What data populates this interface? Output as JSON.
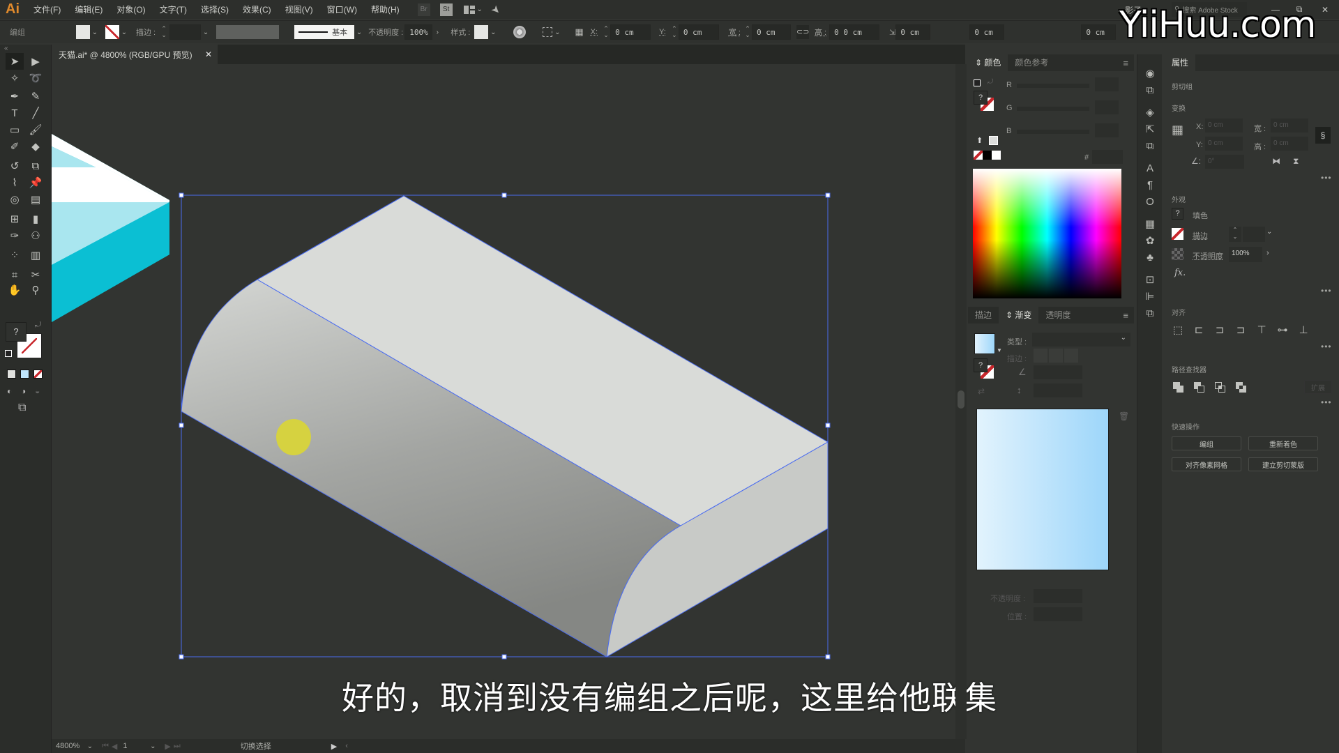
{
  "app": {
    "logo": "Ai",
    "menu": [
      "文件(F)",
      "编辑(E)",
      "对象(O)",
      "文字(T)",
      "选择(S)",
      "效果(C)",
      "视图(V)",
      "窗口(W)",
      "帮助(H)"
    ],
    "bridge_label": "Br",
    "stock_label": "St",
    "workspace_label": "影子",
    "search_placeholder": "搜索 Adobe Stock",
    "window_controls": {
      "minimize": "—",
      "restore": "⧉",
      "close": "✕"
    },
    "watermark": "YiiHuu.com"
  },
  "control_bar": {
    "selection_type": "编组",
    "stroke_label": "描边 :",
    "stroke_profile": "基本",
    "opacity_label": "不透明度 :",
    "opacity_value": "100%",
    "style_label": "样式 :",
    "x_label": "X:",
    "x_value": "0 cm",
    "y_label": "Y:",
    "y_value": "0 cm",
    "w_label": "宽 :",
    "w_value": "0 cm",
    "h_label": "高 :",
    "h_value": "0 0 cm",
    "extra1_value": "0 cm",
    "extra2_value": "0 cm",
    "extra3_value": "0 cm"
  },
  "document_tab": {
    "title": "天猫.ai* @ 4800% (RGB/GPU 预览)",
    "close": "✕"
  },
  "toolbar": {
    "tools": [
      [
        "selection-tool",
        "direct-selection-tool"
      ],
      [
        "magic-wand-tool",
        "lasso-tool"
      ],
      [
        "pen-tool",
        "curvature-tool"
      ],
      [
        "type-tool",
        "line-segment-tool"
      ],
      [
        "rectangle-tool",
        "paintbrush-tool"
      ],
      [
        "shaper-tool",
        "eraser-tool"
      ],
      [
        "rotate-tool",
        "scale-tool"
      ],
      [
        "warp-tool",
        "puppet-warp-tool"
      ],
      [
        "shape-builder-tool",
        "perspective-grid-tool"
      ],
      [
        "mesh-tool",
        "gradient-tool"
      ],
      [
        "eyedropper-tool",
        "blend-tool"
      ],
      [
        "symbol-sprayer-tool",
        "column-graph-tool"
      ],
      [
        "artboard-tool",
        "slice-tool"
      ],
      [
        "hand-tool",
        "zoom-tool"
      ]
    ],
    "fill_unknown": "?"
  },
  "canvas": {
    "zoom_artwork_colors": {
      "top_face": "#d9dbd8",
      "side_light": "#c9cbc8",
      "side_dark": "#8c8e8b",
      "end_face": "#c8cac7",
      "selection": "#4a6cf0",
      "cursor_marker": "#d8d43a",
      "cyan_block": "#0bbfd3",
      "cyan_light": "#a9e6ef"
    }
  },
  "caption": "好的，取消到没有编组之后呢，这里给他联集",
  "status_bar": {
    "zoom": "4800%",
    "artboard": "1",
    "tool_status": "切换选择"
  },
  "color_panel": {
    "tabs": [
      "颜色",
      "颜色参考"
    ],
    "active_tab": "颜色",
    "channels": [
      "R",
      "G",
      "B"
    ],
    "hex_label": "#",
    "fill_unknown": "?"
  },
  "gradient_panel": {
    "tabs": [
      "描边",
      "渐变",
      "透明度"
    ],
    "active_tab": "渐变",
    "type_label": "类型 :",
    "stroke_label": "描边 :",
    "opacity_label": "不透明度 :",
    "location_label": "位置 :",
    "gradient_colors": [
      "#e2f3fd",
      "#9dd6fa"
    ]
  },
  "properties_panel": {
    "title": "属性",
    "object_type": "剪切组",
    "transform": {
      "title": "变换",
      "x_label": "X:",
      "x_value": "0 cm",
      "y_label": "Y:",
      "y_value": "0 cm",
      "w_label": "宽 :",
      "w_value": "0 cm",
      "h_label": "高 :",
      "h_value": "0 cm",
      "angle_value": "0°"
    },
    "appearance": {
      "title": "外观",
      "fill_label": "填色",
      "stroke_label": "描边",
      "opacity_label": "不透明度",
      "opacity_value": "100%",
      "fx_label": "fx."
    },
    "align_title": "对齐",
    "pathfinder": {
      "title": "路径查找器",
      "expand_label": "扩展"
    },
    "quick_actions": {
      "title": "快速操作",
      "buttons": [
        "编组",
        "重新着色",
        "对齐像素网格",
        "建立剪切蒙版"
      ]
    },
    "more": "•••"
  }
}
